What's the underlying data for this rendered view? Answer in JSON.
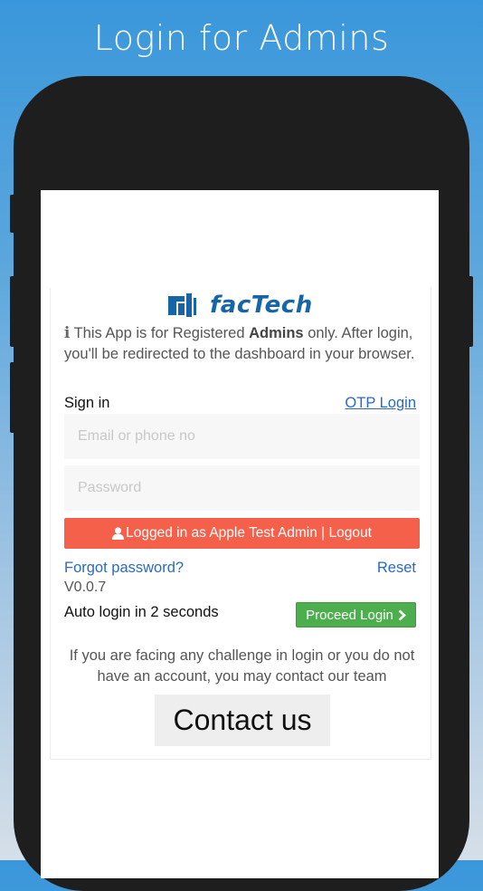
{
  "promo": {
    "title": "Login for Admins"
  },
  "logo": {
    "text": "facTech"
  },
  "info": {
    "icon": "i",
    "text_before": "This App is for Registered ",
    "bold": "Admins",
    "text_after": " only. After login, you'll be redirected to the dashboard in your browser."
  },
  "signin": {
    "label": "Sign in",
    "otp_link": "OTP Login",
    "email_placeholder": "Email or phone no",
    "password_placeholder": "Password",
    "logout_label": "Logged in as Apple Test Admin | Logout",
    "forgot_label": "Forgot password?",
    "reset_label": "Reset",
    "version": "V0.0.7",
    "auto_login_text": "Auto login in 2 seconds",
    "proceed_label": "Proceed Login"
  },
  "help": {
    "text": "If you are facing any challenge in login or you do not have an account, you may contact our team",
    "contact_label": "Contact us"
  },
  "colors": {
    "background_top": "#3a97db",
    "logout_button": "#f4604a",
    "proceed_button": "#4cae4c",
    "link": "#2a6ac0",
    "brand": "#1565a8"
  },
  "icons": [
    "info-icon",
    "user-icon",
    "chevron-right-icon",
    "factech-logo-mark"
  ]
}
